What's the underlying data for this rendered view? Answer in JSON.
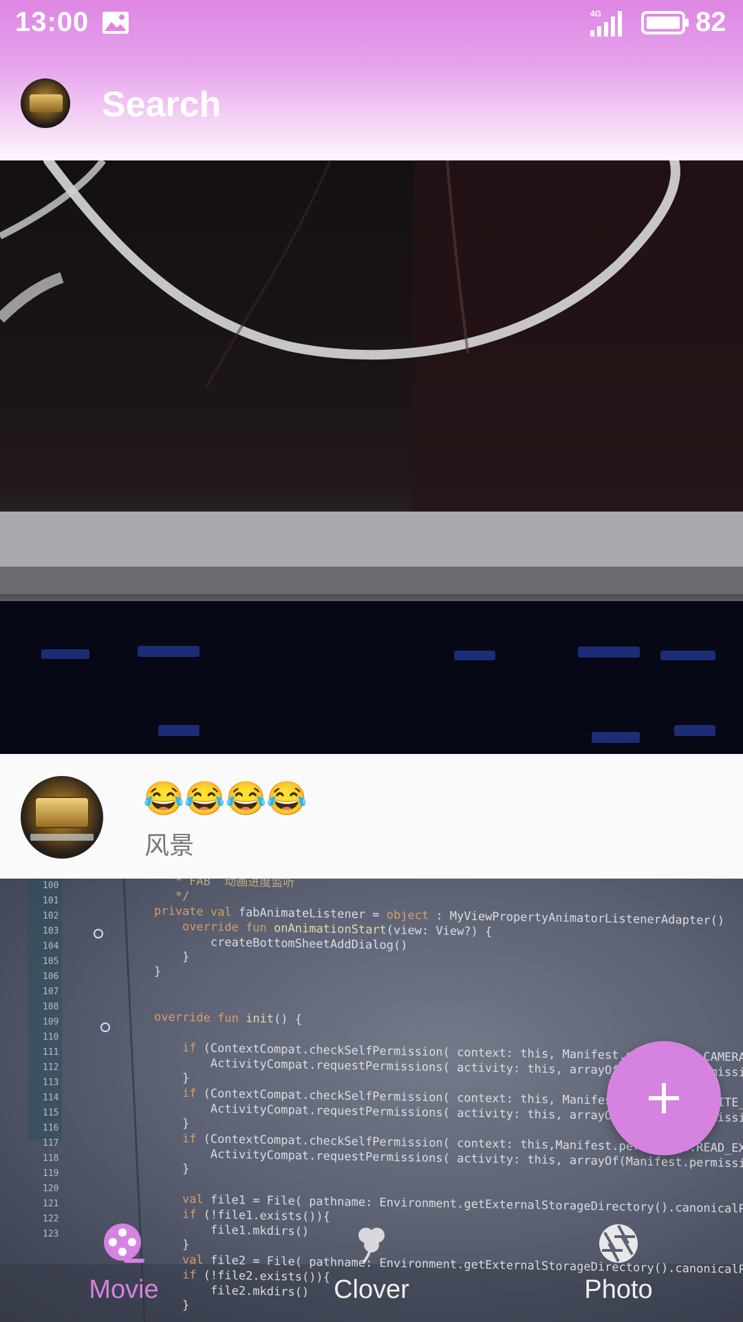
{
  "status_bar": {
    "time": "13:00",
    "network": "4G",
    "battery_level": "82",
    "icons": [
      "image-notification-icon",
      "signal-4g-icon",
      "battery-icon"
    ]
  },
  "header": {
    "search_label": "Search",
    "avatar_icon": "user-avatar"
  },
  "feed": {
    "post": {
      "title": "😂😂😂😂",
      "subtitle": "风景"
    }
  },
  "fab": {
    "icon": "plus-icon"
  },
  "bottom_nav": {
    "items": [
      {
        "label": "Movie",
        "icon": "film-reel-icon",
        "active": true
      },
      {
        "label": "Clover",
        "icon": "clover-icon",
        "active": false
      },
      {
        "label": "Photo",
        "icon": "camera-aperture-icon",
        "active": false
      }
    ],
    "active_color": "#d682e0"
  },
  "colors": {
    "accent": "#d682e0",
    "header_gradient_top": "#dd86e3"
  }
}
